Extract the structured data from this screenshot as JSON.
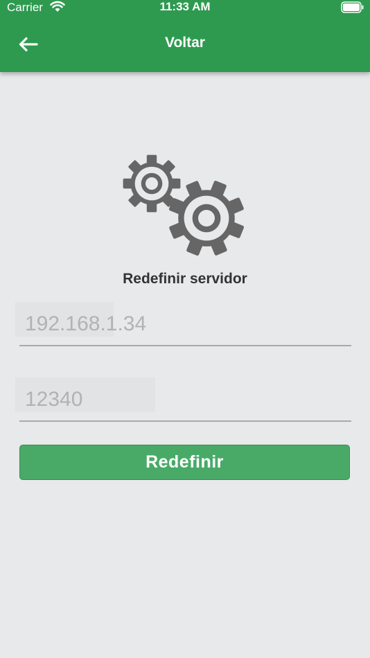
{
  "status_bar": {
    "carrier": "Carrier",
    "time": "11:33 AM",
    "wifi_icon": "wifi-icon",
    "battery_icon": "battery-icon"
  },
  "header": {
    "back_icon": "arrow-left-icon",
    "title": "Voltar"
  },
  "main": {
    "illustration_icon": "gears-icon",
    "title": "Redefinir servidor",
    "ip_field": {
      "value": "",
      "placeholder": "192.168.1.34"
    },
    "port_field": {
      "value": "",
      "placeholder": "12340"
    },
    "submit_label": "Redefinir"
  },
  "colors": {
    "header_background": "#2e9a50",
    "button_background": "#49aa68",
    "page_background": "#e8e9eb",
    "icon_gray": "#666666"
  }
}
